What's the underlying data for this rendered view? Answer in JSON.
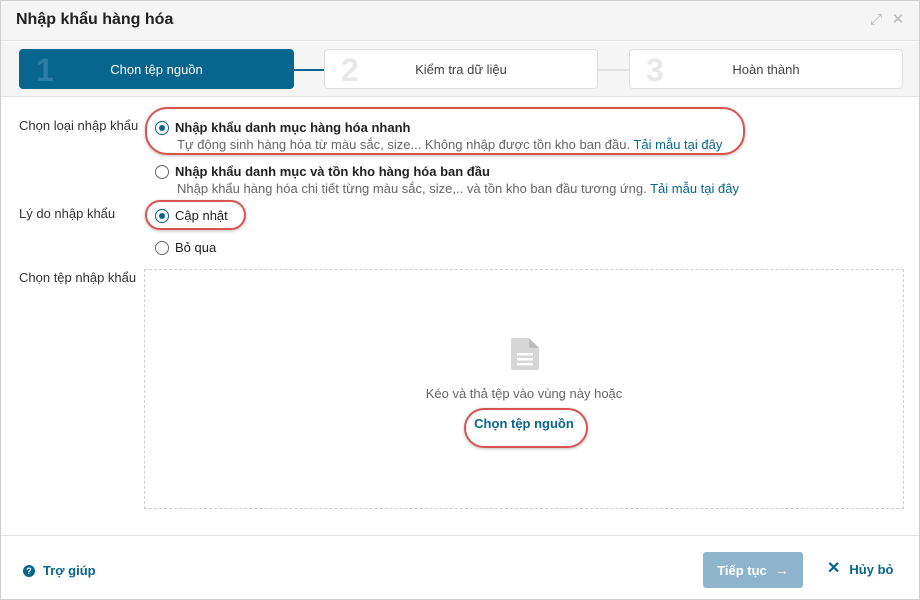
{
  "dialog": {
    "title": "Nhập khẩu hàng hóa",
    "window_icons": [
      "expand-icon",
      "close-icon"
    ]
  },
  "steps": [
    {
      "number": "1",
      "label": "Chọn tệp nguồn",
      "active": true
    },
    {
      "number": "2",
      "label": "Kiểm tra dữ liệu",
      "active": false
    },
    {
      "number": "3",
      "label": "Hoàn thành",
      "active": false
    }
  ],
  "import_type": {
    "label": "Chọn loại nhập khẩu",
    "options": [
      {
        "title": "Nhập khẩu danh mục hàng hóa nhanh",
        "description": "Tự động sinh hàng hóa từ màu sắc, size... Không nhập được tồn kho ban đầu.",
        "link": "Tải mẫu tại đây",
        "checked": true
      },
      {
        "title": "Nhập khẩu danh mục và tồn kho hàng hóa ban đầu",
        "description": "Nhập khẩu hàng hóa chi tiết từng màu sắc, size,.. và tồn kho ban đầu tương ứng.",
        "link": "Tải mẫu tại đây",
        "checked": false
      }
    ]
  },
  "reason": {
    "label": "Lý do nhập khẩu",
    "options": [
      {
        "title": "Cập nhật",
        "checked": true
      },
      {
        "title": "Bỏ qua",
        "checked": false
      }
    ]
  },
  "file_picker": {
    "label": "Chọn tệp nhập khẩu",
    "drop_text": "Kéo và thả tệp vào vùng này hoặc",
    "pick_link": "Chọn tệp nguồn",
    "icon": "file-document-icon"
  },
  "footer": {
    "help_label": "Trợ giúp",
    "next_label": "Tiếp tục",
    "cancel_label": "Hủy bỏ"
  },
  "colors": {
    "primary": "#07658e",
    "highlight": "#d9534f",
    "disabled_button": "#8fb5cc"
  }
}
